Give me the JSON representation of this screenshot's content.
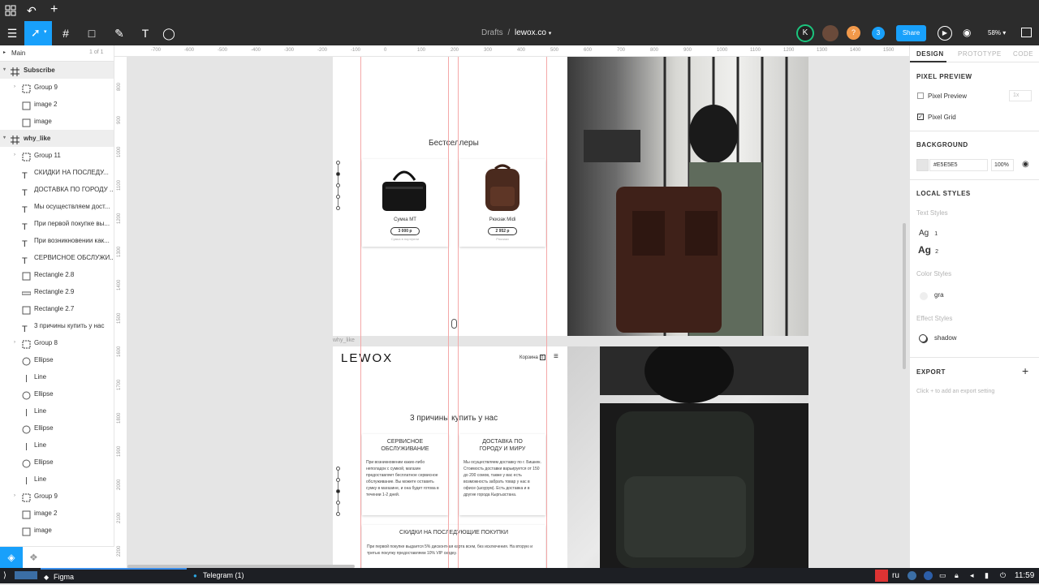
{
  "topbar": {
    "title_prefix": "Drafts",
    "title_sep": "/",
    "file_name": "lewox.co",
    "share_label": "Share",
    "zoom": "58%",
    "user_badge": "K",
    "user_count": "3"
  },
  "left_panel": {
    "page_name": "Main",
    "page_count": "1 of 1",
    "layers": [
      {
        "label": "Subscribe",
        "kind": "frame",
        "indent": 0
      },
      {
        "label": "Group 9",
        "kind": "group",
        "indent": 1
      },
      {
        "label": "image 2",
        "kind": "rect",
        "indent": 1
      },
      {
        "label": "image",
        "kind": "rect",
        "indent": 1
      },
      {
        "label": "why_like",
        "kind": "frame",
        "indent": 0
      },
      {
        "label": "Group 11",
        "kind": "group",
        "indent": 1
      },
      {
        "label": "СКИДКИ НА ПОСЛЕДУ...",
        "kind": "text",
        "indent": 1
      },
      {
        "label": "ДОСТАВКА ПО ГОРОДУ ...",
        "kind": "text",
        "indent": 1
      },
      {
        "label": "Мы осуществляем дост...",
        "kind": "text",
        "indent": 1
      },
      {
        "label": "При первой покупке вы...",
        "kind": "text",
        "indent": 1
      },
      {
        "label": "При возникновении как...",
        "kind": "text",
        "indent": 1
      },
      {
        "label": "СЕРВИСНОЕ ОБСЛУЖИ...",
        "kind": "text",
        "indent": 1
      },
      {
        "label": "Rectangle 2.8",
        "kind": "rect",
        "indent": 1
      },
      {
        "label": "Rectangle 2.9",
        "kind": "line-rect",
        "indent": 1
      },
      {
        "label": "Rectangle 2.7",
        "kind": "rect",
        "indent": 1
      },
      {
        "label": "3 причины купить у нас",
        "kind": "text",
        "indent": 1
      },
      {
        "label": "Group 8",
        "kind": "group",
        "indent": 1
      },
      {
        "label": "Ellipse",
        "kind": "ellipse",
        "indent": 1
      },
      {
        "label": "Line",
        "kind": "line",
        "indent": 1
      },
      {
        "label": "Ellipse",
        "kind": "ellipse",
        "indent": 1
      },
      {
        "label": "Line",
        "kind": "line",
        "indent": 1
      },
      {
        "label": "Ellipse",
        "kind": "ellipse",
        "indent": 1
      },
      {
        "label": "Line",
        "kind": "line",
        "indent": 1
      },
      {
        "label": "Ellipse",
        "kind": "ellipse",
        "indent": 1
      },
      {
        "label": "Line",
        "kind": "line",
        "indent": 1
      },
      {
        "label": "Group 9",
        "kind": "group",
        "indent": 1
      },
      {
        "label": "image 2",
        "kind": "rect",
        "indent": 1
      },
      {
        "label": "image",
        "kind": "rect",
        "indent": 1
      }
    ]
  },
  "right_panel": {
    "tabs": [
      "DESIGN",
      "PROTOTYPE",
      "CODE"
    ],
    "pixel_preview_title": "PIXEL PREVIEW",
    "pixel_preview_label": "Pixel Preview",
    "pixel_preview_scale": "1x",
    "pixel_grid_label": "Pixel Grid",
    "background_title": "BACKGROUND",
    "background_hex": "#E5E5E5",
    "background_opacity": "100%",
    "local_styles_title": "LOCAL STYLES",
    "text_styles_label": "Text Styles",
    "text_style_sample": "Ag",
    "text_style_1": "1",
    "text_style_2": "2",
    "color_styles_label": "Color Styles",
    "color_style_name": "gra",
    "effect_styles_label": "Effect Styles",
    "effect_style_name": "shadow",
    "export_title": "EXPORT",
    "export_hint": "Click + to add an export setting"
  },
  "ruler_h": [
    "-700",
    "-600",
    "-500",
    "-400",
    "-300",
    "-200",
    "-100",
    "0",
    "100",
    "200",
    "300",
    "400",
    "500",
    "600",
    "700",
    "800",
    "900",
    "1000",
    "1100",
    "1200",
    "1300",
    "1400",
    "1500"
  ],
  "ruler_v": [
    "800",
    "900",
    "1000",
    "1100",
    "1200",
    "1300",
    "1400",
    "1500",
    "1600",
    "1700",
    "1800",
    "1900",
    "2000",
    "2100",
    "2200"
  ],
  "canvas": {
    "frame1": {
      "section_title": "Бестселлеры",
      "product1_name": "Сумка MT",
      "product1_price": "3 000 р",
      "product1_sub": "Сумка в портфели",
      "product2_name": "Рюкзак Midi",
      "product2_price": "2 952 р",
      "product2_sub": "Рюкзаки"
    },
    "frame2_label": "why_like",
    "frame2": {
      "logo": "LEWOX",
      "cart_label": "Корзина",
      "cart_count": "0",
      "title": "3 причины купить у нас",
      "card1_title": "СЕРВИСНОЕ ОБСЛУЖИВАНИЕ",
      "card1_text": "При возникновении каких-либо неполадок с сумкой, магазин предоставляет бесплатное сервисное обслуживание. Вы можете оставить сумку в магазине, и она будет готова в течении 1-2 дней.",
      "card2_title": "ДОСТАВКА ПО ГОРОДУ И МИРУ",
      "card2_text": "Мы осуществляем доставку по г. Бишкек. Стоимость доставки варьируется от 150 до 200 сомов, также у вас есть возможность забрать товар у нас в офисе (шоурум). Есть доставка и в другие города Кыргызстана.",
      "card3_title": "СКИДКИ НА ПОСЛЕДУЮЩИЕ ПОКУПКИ",
      "card3_text": "При первой покупке выдается 5% дисконтная карта всем, без исключения. На вторую и третью покупку предоставляем 10% VIP скидку."
    }
  },
  "taskbar": {
    "app1": "Figma",
    "app2": "Telegram (1)",
    "lang": "ru",
    "time": "11:59"
  },
  "colors": {
    "accent": "#18a0fb",
    "guide": "#f4a8a8",
    "canvas_bg": "#e5e5e5",
    "dark_bar": "#2c2c2c"
  }
}
